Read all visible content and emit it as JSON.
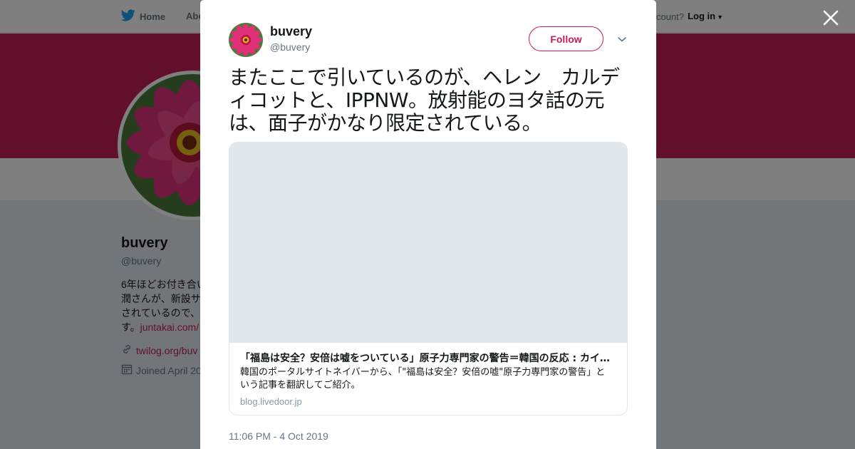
{
  "topbar": {
    "home_label": "Home",
    "about_label": "Abo",
    "account_prompt": "count?",
    "login_label": "Log in"
  },
  "profile": {
    "name": "buvery",
    "handle": "@buvery",
    "bio_text": "6年ほどお付き合い\n潤さんが、新設サ\nされているので、\nす。",
    "bio_link": "juntakai.com/",
    "website": "twilog.org/buv",
    "joined": "Joined April 20"
  },
  "tweet": {
    "name": "buvery",
    "handle": "@buvery",
    "follow_label": "Follow",
    "text": "またここで引いているのが、ヘレン　カルディコットと、IPPNW。放射能のヨタ話の元は、面子がかなり限定されている。",
    "timestamp": "11:06 PM - 4 Oct 2019",
    "card": {
      "title": "「福島は安全？安倍は嘘をついている」原子力専門家の警告＝韓国の反応 : カイ…",
      "description": "韓国のポータルサイトネイバーから、「\"福島は安全？安倍の嘘\"原子力専門家の警告」という記事を翻訳してご紹介。",
      "domain": "blog.livedoor.jp"
    }
  },
  "colors": {
    "brand": "#c41e58",
    "twitter_blue": "#1da1f2",
    "card_placeholder": "#e1e8ed"
  },
  "icons": {
    "bird": "twitter-bird-icon",
    "close": "close-icon",
    "caret": "chevron-down-icon",
    "link": "link-icon",
    "calendar": "calendar-icon"
  }
}
